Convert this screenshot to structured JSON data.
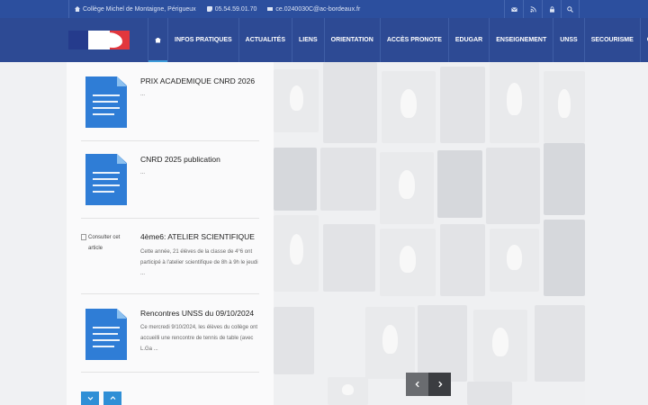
{
  "topbar": {
    "address": "Collège Michel de Montaigne, Périgueux",
    "phone": "05.54.59.01.70",
    "email": "ce.0240030C@ac-bordeaux.fr",
    "icons": [
      "mail-icon",
      "rss-icon",
      "lock-icon",
      "search-icon"
    ]
  },
  "nav": {
    "items": [
      {
        "label": "INFOS PRATIQUES"
      },
      {
        "label": "ACTUALITÉS"
      },
      {
        "label": "LIENS"
      },
      {
        "label": "ORIENTATION"
      },
      {
        "label": "ACCÈS PRONOTE"
      },
      {
        "label": "EDUGAR"
      },
      {
        "label": "ENSEIGNEMENT"
      },
      {
        "label": "UNSS"
      },
      {
        "label": "SECOURISME"
      },
      {
        "label": "CDI"
      }
    ]
  },
  "articles": [
    {
      "title": "PRIX ACADEMIQUE CNRD 2026",
      "excerpt": "..."
    },
    {
      "title": "CNRD 2025 publication",
      "excerpt": "..."
    },
    {
      "title": "4ème6: ATELIER SCIENTIFIQUE",
      "excerpt": "Cette année, 21 élèves de la classe de 4°6 ont participé à l'atelier scientifique de 8h à 9h le jeudi ...",
      "image_alt": "Consulter cet article"
    },
    {
      "title": "Rencontres UNSS du 09/10/2024",
      "excerpt": "Ce mercredi 9/10/2024, les élèves du collège ont accueilli une rencontre de tennis de table (avec L.Ga ..."
    }
  ],
  "colors": {
    "topbar": "#2c4f9e",
    "header": "#2d4a94",
    "accent": "#2f8fd6",
    "doc_icon": "#2f7dd6"
  }
}
